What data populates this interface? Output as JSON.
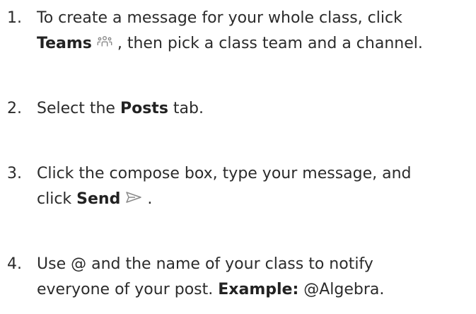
{
  "steps": [
    {
      "number": "1.",
      "line1": "To create a message for your whole class, click",
      "bold": "Teams",
      "icon": "teams-icon",
      "after_icon": " , then pick a class team and a channel."
    },
    {
      "number": "2.",
      "pre": "Select the ",
      "bold": "Posts",
      "post": " tab."
    },
    {
      "number": "3.",
      "line1": "Click the compose box, type your message, and",
      "pre": "click ",
      "bold": "Send",
      "icon": "send-icon",
      "after_icon": " ."
    },
    {
      "number": "4.",
      "line1": "Use @ and the name of your class to notify",
      "pre": "everyone of your post. ",
      "bold": "Example:",
      "post": " @Algebra."
    }
  ],
  "colors": {
    "text": "#2b2b2b",
    "icon": "#8a8a8a",
    "background": "#ffffff"
  }
}
